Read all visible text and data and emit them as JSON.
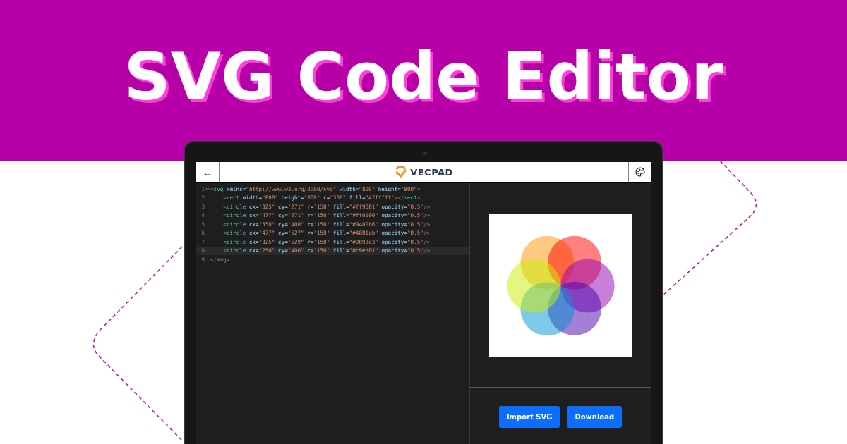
{
  "headline": "SVG Code Editor",
  "app": {
    "back_button": "←",
    "logo": "VECPAD",
    "code_lines": [
      {
        "number": "1",
        "text": "<svg xmlns=\"http://www.w3.org/2000/svg\" width=\"800\" height=\"800\">",
        "foldable": true,
        "selected": false
      },
      {
        "number": "2",
        "text": "    <rect width=\"800\" height=\"800\" r=\"300\" fill=\"#ffffff\"></rect>",
        "foldable": false,
        "selected": false
      },
      {
        "number": "3",
        "text": "    <circle cx=\"325\" cy=\"271\" r=\"150\" fill=\"#ff9601\" opacity=\"0.5\"/>",
        "foldable": false,
        "selected": false
      },
      {
        "number": "4",
        "text": "    <circle cx=\"477\" cy=\"271\" r=\"150\" fill=\"#ff0100\" opacity=\"0.5\"/>",
        "foldable": false,
        "selected": false
      },
      {
        "number": "5",
        "text": "    <circle cx=\"550\" cy=\"400\" r=\"150\" fill=\"#9400b6\" opacity=\"0.5\"/>",
        "foldable": false,
        "selected": false
      },
      {
        "number": "6",
        "text": "    <circle cx=\"477\" cy=\"527\" r=\"150\" fill=\"#4801ab\" opacity=\"0.5\"/>",
        "foldable": false,
        "selected": false
      },
      {
        "number": "7",
        "text": "    <circle cx=\"325\" cy=\"529\" r=\"150\" fill=\"#0093d3\" opacity=\"0.5\"/>",
        "foldable": false,
        "selected": false
      },
      {
        "number": "8",
        "text": "    <circle cx=\"250\" cy=\"400\" r=\"150\" fill=\"#c9ed01\" opacity=\"0.5\"/>",
        "foldable": false,
        "selected": true
      },
      {
        "number": "9",
        "text": "</svg>",
        "foldable": false,
        "selected": false
      }
    ],
    "buttons": [
      {
        "label": "Import SVG"
      },
      {
        "label": "Download"
      }
    ]
  }
}
